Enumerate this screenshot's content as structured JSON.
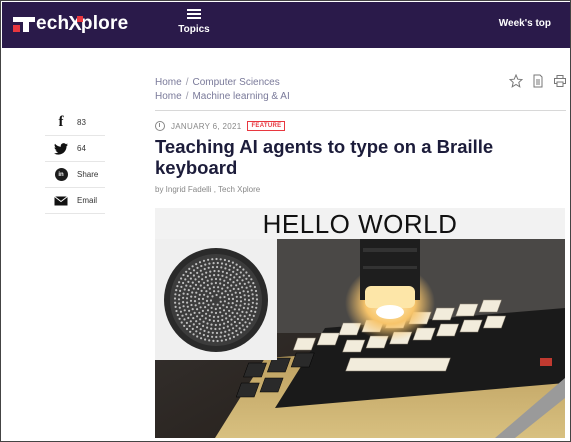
{
  "header": {
    "logo_text": "TechXplore",
    "topics_label": "Topics",
    "weeks_top_label": "Week's top"
  },
  "breadcrumbs": [
    [
      "Home",
      "Computer Sciences"
    ],
    [
      "Home",
      "Machine learning & AI"
    ]
  ],
  "toolbar_icons": [
    "star-icon",
    "pdf-icon",
    "print-icon"
  ],
  "share": {
    "facebook": {
      "icon": "facebook-icon",
      "count": "83"
    },
    "twitter": {
      "icon": "twitter-icon",
      "count": "64"
    },
    "linkedin": {
      "icon": "linkedin-icon",
      "label": "Share"
    },
    "email": {
      "icon": "email-icon",
      "label": "Email"
    }
  },
  "article": {
    "date": "JANUARY 6, 2021",
    "badge": "FEATURE",
    "title": "Teaching AI agents to type on a Braille keyboard",
    "byline": "by Ingrid Fadelli , Tech Xplore",
    "image_caption": "HELLO WORLD"
  },
  "colors": {
    "header_bg": "#2a1a4a",
    "accent_red": "#e8373f",
    "headline": "#1c1c3a"
  }
}
